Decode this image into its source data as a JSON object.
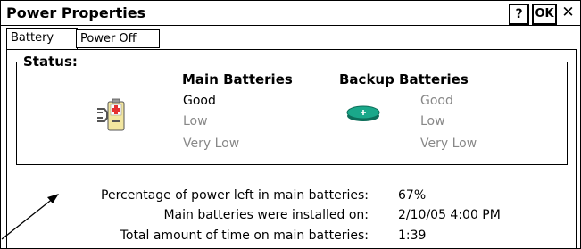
{
  "window": {
    "title": "Power Properties",
    "help_label": "?",
    "ok_label": "OK",
    "close_label": "✕"
  },
  "tabs": [
    {
      "label": "Battery",
      "active": true
    },
    {
      "label": "Power Off",
      "active": false
    }
  ],
  "status": {
    "group_label": "Status:",
    "main": {
      "heading": "Main Batteries",
      "levels": [
        "Good",
        "Low",
        "Very Low"
      ],
      "current": "Good"
    },
    "backup": {
      "heading": "Backup Batteries",
      "levels": [
        "Good",
        "Low",
        "Very Low"
      ],
      "current": null
    }
  },
  "info": [
    {
      "label": "Percentage of power left in main batteries:",
      "value": "67%"
    },
    {
      "label": "Main batteries were installed on:",
      "value": "2/10/05 4:00 PM"
    },
    {
      "label": "Total amount of time on main batteries:",
      "value": "1:39"
    }
  ],
  "colors": {
    "battery_body": "#f2e6a0",
    "battery_red": "#e53030",
    "coin": "#1aa88a"
  }
}
